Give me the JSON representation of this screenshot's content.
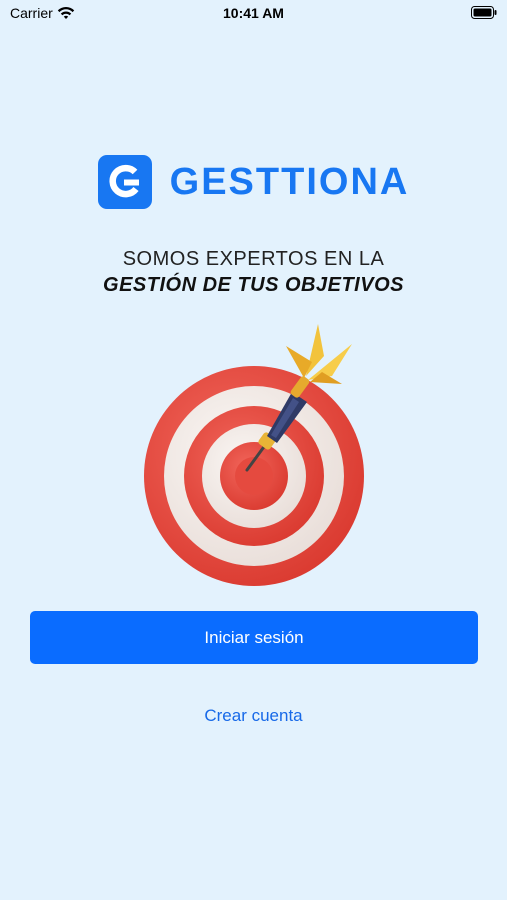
{
  "status_bar": {
    "carrier": "Carrier",
    "time": "10:41 AM",
    "icons": [
      "wifi-icon",
      "battery-icon"
    ]
  },
  "brand": {
    "name": "GESTTIONA",
    "logo_icon": "g-logo-icon",
    "color": "#1877f2"
  },
  "tagline": {
    "line1": "SOMOS EXPERTOS EN LA",
    "line2": "GESTIÓN DE TUS OBJETIVOS"
  },
  "illustration": {
    "name": "target-with-dart",
    "ring_colors": [
      "#e8463c",
      "#f2ebe6"
    ]
  },
  "actions": {
    "login_label": "Iniciar sesión",
    "signup_label": "Crear cuenta",
    "primary_color": "#0a6cff"
  },
  "background_color": "#e3f2fd"
}
